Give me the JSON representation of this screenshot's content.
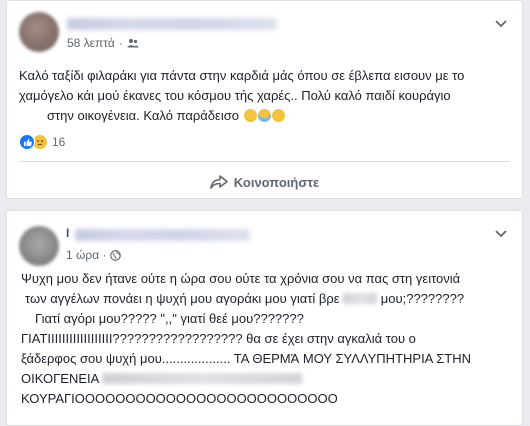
{
  "posts": [
    {
      "time": "58 λεπτά",
      "text_line1": "Καλό ταξίδι φιλαράκι για πάντα στην καρδιά μάς όπου σε έβλεπα εισουν με το",
      "text_line2": "χαμόγελο κάι μού έκανες του κόσμου τής χαρές.. Πολύ καλό παιδί κουράγιο",
      "text_line3": "στην οικογένεια. Καλό παράδεισο",
      "reaction_count": "16",
      "share_label": "Κοινοποιήστε"
    },
    {
      "name_initial": "Ι",
      "time": "1 ώρα ·",
      "line1": "Ψυχη μου δεν ήτανε ούτε η ώρα σου ούτε τα χρόνια σου να πας στη γειτονιά",
      "line2a": "των αγγέλων πονάει η ψυχή μου αγοράκι μου γιατί βρε ",
      "line2b": " μου;????????",
      "line3": "Γιατί αγόρι μου????? \",,\" γιατί θεέ μου???????",
      "line4": "ΓΙΑΤΙΙΙΙΙΙΙΙΙΙΙΙΙΙΙΙΙΙ?????????????????? θα σε έχει στην αγκαλιά του ο",
      "line5": "ξάδερφος σου ψυχή μου................... ΤΑ ΘΕΡΜΆ ΜΟΥ ΣΥΛΛΥΠΗΤΗΡΙΑ ΣΤΗΝ",
      "line6": "ΟΙΚΟΓΕΝΕΙΑ",
      "line7": "ΚΟΥΡΑΓΙΟΟΟΟΟΟΟΟΟΟΟΟΟΟΟΟΟΟΟΟΟΟΟΟΟΟ"
    }
  ],
  "icons": {
    "audience": "friends-icon",
    "globe": "globe-icon",
    "share": "share-arrow-icon",
    "options": "chevron-down-icon"
  },
  "colors": {
    "like": "#1877f2",
    "sad": "#f5c33b",
    "link": "#365899",
    "meta": "#616770"
  }
}
